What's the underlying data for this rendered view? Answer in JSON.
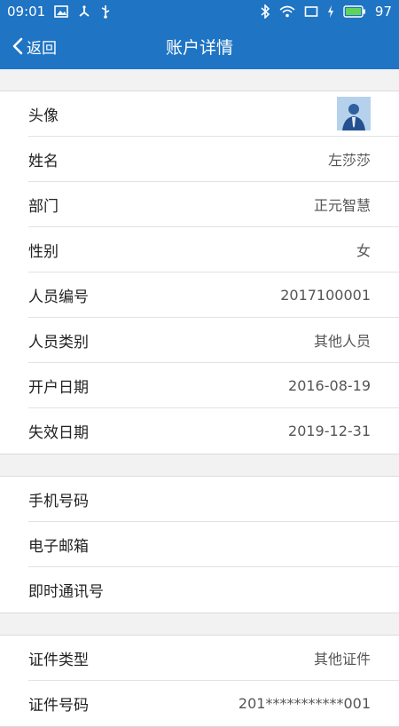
{
  "status_bar": {
    "time": "09:01",
    "battery": "97",
    "icons": [
      "image-icon",
      "usb-tether-icon",
      "usb-icon",
      "bluetooth-icon",
      "wifi-icon",
      "screen-icon",
      "charging-icon",
      "battery-icon"
    ]
  },
  "nav": {
    "back_label": "返回",
    "title": "账户详情"
  },
  "group1": [
    {
      "label": "头像",
      "value": ""
    },
    {
      "label": "姓名",
      "value": "左莎莎"
    },
    {
      "label": "部门",
      "value": "正元智慧"
    },
    {
      "label": "性别",
      "value": "女"
    },
    {
      "label": "人员编号",
      "value": "2017100001"
    },
    {
      "label": "人员类别",
      "value": "其他人员"
    },
    {
      "label": "开户日期",
      "value": "2016-08-19"
    },
    {
      "label": "失效日期",
      "value": "2019-12-31"
    }
  ],
  "group2": [
    {
      "label": "手机号码",
      "value": ""
    },
    {
      "label": "电子邮箱",
      "value": ""
    },
    {
      "label": "即时通讯号",
      "value": ""
    }
  ],
  "group3": [
    {
      "label": "证件类型",
      "value": "其他证件"
    },
    {
      "label": "证件号码",
      "value": "201***********001"
    }
  ],
  "colors": {
    "accent": "#1f74c4",
    "background": "#f2f2f2"
  }
}
